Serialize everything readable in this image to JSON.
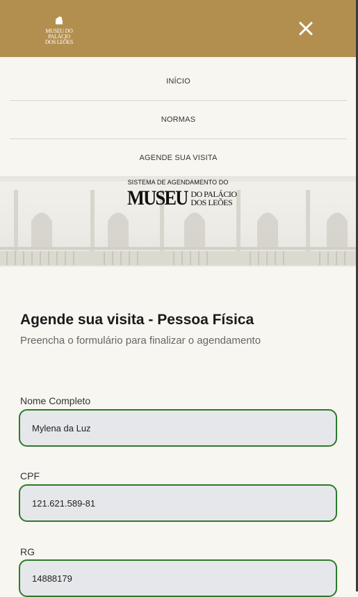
{
  "header": {
    "logo_lines": [
      "MUSEU DO",
      "PALÁCIO",
      "DOS LEÕES"
    ],
    "brand_color": "#b38f4f",
    "close_icon": "close-icon"
  },
  "menu": {
    "items": [
      {
        "label": "INÍCIO"
      },
      {
        "label": "NORMAS"
      },
      {
        "label": "AGENDE SUA VISITA"
      }
    ]
  },
  "banner": {
    "title": "SISTEMA DE AGENDAMENTO DO",
    "logo_big": "MUSEU",
    "logo_line1": "DO PALÁCIO",
    "logo_line2": "DOS LEÕES"
  },
  "form": {
    "title": "Agende sua visita - Pessoa Física",
    "subtitle": "Preencha o formulário para finalizar o agendamento",
    "fields": [
      {
        "label": "Nome Completo",
        "value": "Mylena da Luz"
      },
      {
        "label": "CPF",
        "value": "121.621.589-81"
      },
      {
        "label": "RG",
        "value": "14888179"
      }
    ],
    "field_border_color": "#2a7a2a"
  }
}
